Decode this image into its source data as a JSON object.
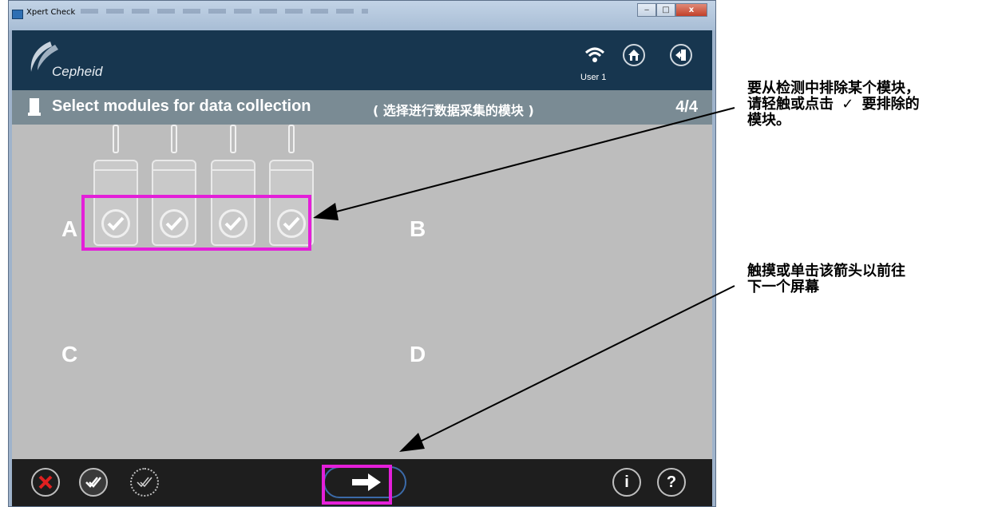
{
  "window": {
    "title": "Xpert Check",
    "buttons": {
      "minimize": "‒",
      "maximize": "□",
      "close": "x"
    }
  },
  "header": {
    "logo_text": "Cepheid",
    "user_label": "User 1",
    "icons": [
      "wifi-icon",
      "home-icon",
      "logout-icon"
    ]
  },
  "subheader": {
    "title": "Select modules for data collection",
    "title_cn": "( 选择进行数据采集的模块 )",
    "page": "4/4"
  },
  "bays": {
    "a": "A",
    "b": "B",
    "c": "C",
    "d": "D"
  },
  "modules": [
    {
      "id": 1,
      "checked": true
    },
    {
      "id": 2,
      "checked": true
    },
    {
      "id": 3,
      "checked": true
    },
    {
      "id": 4,
      "checked": true
    }
  ],
  "footer": {
    "cancel_icon": "cancel-icon",
    "select_all_icon": "select-all-icon",
    "deselect_all_icon": "deselect-all-icon",
    "next_icon": "arrow-right-icon",
    "info_label": "i",
    "help_label": "?"
  },
  "annotations": {
    "exclude_note_line1": "要从检测中排除某个模块，",
    "exclude_note_line2a": "请轻触或点击",
    "exclude_note_check": "✓",
    "exclude_note_line2b": "要排除的",
    "exclude_note_line3": "模块。",
    "next_note_line1": "触摸或单击该箭头以前往",
    "next_note_line2": "下一个屏幕"
  },
  "colors": {
    "header": "#17364f",
    "subheader": "#7a8b94",
    "content": "#bdbdbd",
    "footer": "#1e1e1e",
    "highlight": "#e41fd9",
    "cancel": "#e02020"
  }
}
